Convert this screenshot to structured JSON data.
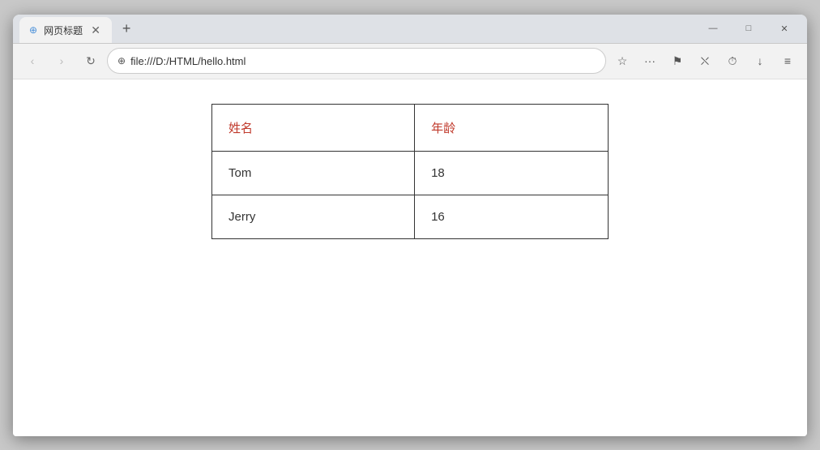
{
  "browser": {
    "tab_title": "网页标题",
    "url": "file:///D:/HTML/hello.html",
    "new_tab_label": "+",
    "nav": {
      "back": "‹",
      "forward": "›",
      "reload": "↻"
    },
    "window_controls": {
      "minimize": "—",
      "maximize": "□",
      "close": "✕"
    },
    "toolbar": {
      "bookmark": "☆",
      "more": "···",
      "collections": "⚑",
      "split": "⛌",
      "history": "⏱",
      "download": "↓",
      "menu": "≡"
    }
  },
  "table": {
    "headers": [
      "姓名",
      "年龄"
    ],
    "rows": [
      [
        "Tom",
        "18"
      ],
      [
        "Jerry",
        "16"
      ]
    ]
  }
}
